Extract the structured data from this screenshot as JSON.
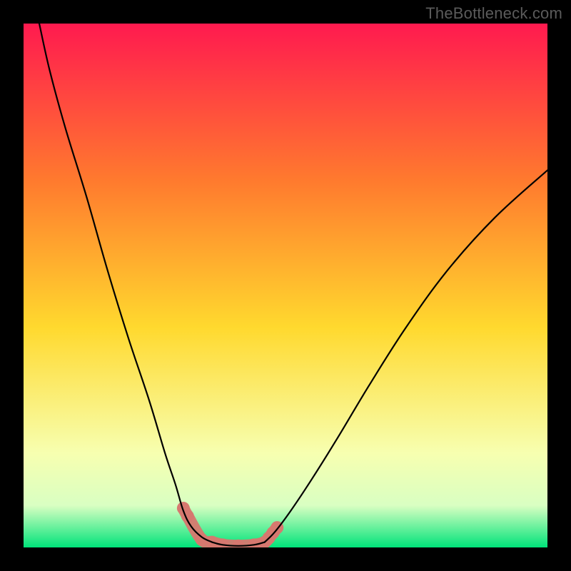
{
  "watermark": "TheBottleneck.com",
  "colors": {
    "gradient_top": "#ff1a4f",
    "gradient_mid_upper": "#ff7a2e",
    "gradient_mid": "#ffd92e",
    "gradient_lower": "#f7ffb0",
    "gradient_bottom": "#00e37a",
    "curve": "#000000",
    "beads": "#d6786f",
    "frame": "#000000"
  },
  "chart_data": {
    "type": "line",
    "title": "",
    "xlabel": "",
    "ylabel": "",
    "xlim": [
      0,
      100
    ],
    "ylim": [
      0,
      100
    ],
    "series": [
      {
        "name": "left-curve",
        "x": [
          3,
          5,
          8,
          12,
          16,
          20,
          24,
          27,
          29,
          30.5,
          32,
          34,
          36
        ],
        "values": [
          100,
          91,
          80,
          67,
          53,
          40,
          28,
          18,
          12,
          7,
          4,
          2,
          1
        ]
      },
      {
        "name": "valley-floor",
        "x": [
          36,
          38,
          41,
          44,
          46
        ],
        "values": [
          1,
          0.5,
          0.3,
          0.5,
          1
        ]
      },
      {
        "name": "right-curve",
        "x": [
          46,
          48,
          51,
          55,
          60,
          66,
          73,
          81,
          90,
          100
        ],
        "values": [
          1,
          3,
          7,
          13,
          21,
          31,
          42,
          53,
          63,
          72
        ]
      }
    ],
    "beads": {
      "x": [
        30.5,
        31.3,
        34,
        36,
        38,
        41,
        44,
        46,
        46.8,
        47.6,
        48.4
      ],
      "values": [
        7.5,
        6.0,
        1.5,
        1,
        0.5,
        0.3,
        0.5,
        1,
        1.8,
        2.8,
        3.8
      ]
    }
  }
}
